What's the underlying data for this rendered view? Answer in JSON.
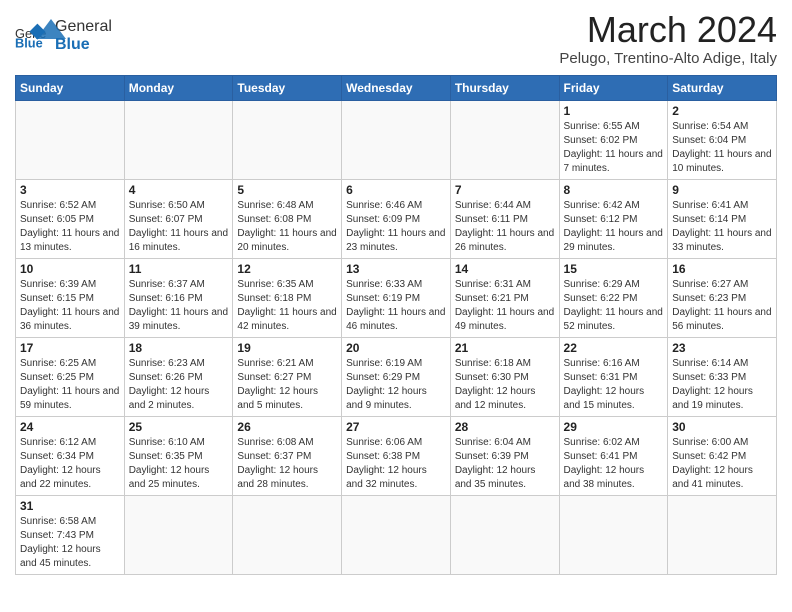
{
  "logo": {
    "text_general": "General",
    "text_blue": "Blue"
  },
  "header": {
    "month_year": "March 2024",
    "location": "Pelugo, Trentino-Alto Adige, Italy"
  },
  "weekdays": [
    "Sunday",
    "Monday",
    "Tuesday",
    "Wednesday",
    "Thursday",
    "Friday",
    "Saturday"
  ],
  "weeks": [
    [
      {
        "day": "",
        "info": ""
      },
      {
        "day": "",
        "info": ""
      },
      {
        "day": "",
        "info": ""
      },
      {
        "day": "",
        "info": ""
      },
      {
        "day": "",
        "info": ""
      },
      {
        "day": "1",
        "info": "Sunrise: 6:55 AM\nSunset: 6:02 PM\nDaylight: 11 hours and 7 minutes."
      },
      {
        "day": "2",
        "info": "Sunrise: 6:54 AM\nSunset: 6:04 PM\nDaylight: 11 hours and 10 minutes."
      }
    ],
    [
      {
        "day": "3",
        "info": "Sunrise: 6:52 AM\nSunset: 6:05 PM\nDaylight: 11 hours and 13 minutes."
      },
      {
        "day": "4",
        "info": "Sunrise: 6:50 AM\nSunset: 6:07 PM\nDaylight: 11 hours and 16 minutes."
      },
      {
        "day": "5",
        "info": "Sunrise: 6:48 AM\nSunset: 6:08 PM\nDaylight: 11 hours and 20 minutes."
      },
      {
        "day": "6",
        "info": "Sunrise: 6:46 AM\nSunset: 6:09 PM\nDaylight: 11 hours and 23 minutes."
      },
      {
        "day": "7",
        "info": "Sunrise: 6:44 AM\nSunset: 6:11 PM\nDaylight: 11 hours and 26 minutes."
      },
      {
        "day": "8",
        "info": "Sunrise: 6:42 AM\nSunset: 6:12 PM\nDaylight: 11 hours and 29 minutes."
      },
      {
        "day": "9",
        "info": "Sunrise: 6:41 AM\nSunset: 6:14 PM\nDaylight: 11 hours and 33 minutes."
      }
    ],
    [
      {
        "day": "10",
        "info": "Sunrise: 6:39 AM\nSunset: 6:15 PM\nDaylight: 11 hours and 36 minutes."
      },
      {
        "day": "11",
        "info": "Sunrise: 6:37 AM\nSunset: 6:16 PM\nDaylight: 11 hours and 39 minutes."
      },
      {
        "day": "12",
        "info": "Sunrise: 6:35 AM\nSunset: 6:18 PM\nDaylight: 11 hours and 42 minutes."
      },
      {
        "day": "13",
        "info": "Sunrise: 6:33 AM\nSunset: 6:19 PM\nDaylight: 11 hours and 46 minutes."
      },
      {
        "day": "14",
        "info": "Sunrise: 6:31 AM\nSunset: 6:21 PM\nDaylight: 11 hours and 49 minutes."
      },
      {
        "day": "15",
        "info": "Sunrise: 6:29 AM\nSunset: 6:22 PM\nDaylight: 11 hours and 52 minutes."
      },
      {
        "day": "16",
        "info": "Sunrise: 6:27 AM\nSunset: 6:23 PM\nDaylight: 11 hours and 56 minutes."
      }
    ],
    [
      {
        "day": "17",
        "info": "Sunrise: 6:25 AM\nSunset: 6:25 PM\nDaylight: 11 hours and 59 minutes."
      },
      {
        "day": "18",
        "info": "Sunrise: 6:23 AM\nSunset: 6:26 PM\nDaylight: 12 hours and 2 minutes."
      },
      {
        "day": "19",
        "info": "Sunrise: 6:21 AM\nSunset: 6:27 PM\nDaylight: 12 hours and 5 minutes."
      },
      {
        "day": "20",
        "info": "Sunrise: 6:19 AM\nSunset: 6:29 PM\nDaylight: 12 hours and 9 minutes."
      },
      {
        "day": "21",
        "info": "Sunrise: 6:18 AM\nSunset: 6:30 PM\nDaylight: 12 hours and 12 minutes."
      },
      {
        "day": "22",
        "info": "Sunrise: 6:16 AM\nSunset: 6:31 PM\nDaylight: 12 hours and 15 minutes."
      },
      {
        "day": "23",
        "info": "Sunrise: 6:14 AM\nSunset: 6:33 PM\nDaylight: 12 hours and 19 minutes."
      }
    ],
    [
      {
        "day": "24",
        "info": "Sunrise: 6:12 AM\nSunset: 6:34 PM\nDaylight: 12 hours and 22 minutes."
      },
      {
        "day": "25",
        "info": "Sunrise: 6:10 AM\nSunset: 6:35 PM\nDaylight: 12 hours and 25 minutes."
      },
      {
        "day": "26",
        "info": "Sunrise: 6:08 AM\nSunset: 6:37 PM\nDaylight: 12 hours and 28 minutes."
      },
      {
        "day": "27",
        "info": "Sunrise: 6:06 AM\nSunset: 6:38 PM\nDaylight: 12 hours and 32 minutes."
      },
      {
        "day": "28",
        "info": "Sunrise: 6:04 AM\nSunset: 6:39 PM\nDaylight: 12 hours and 35 minutes."
      },
      {
        "day": "29",
        "info": "Sunrise: 6:02 AM\nSunset: 6:41 PM\nDaylight: 12 hours and 38 minutes."
      },
      {
        "day": "30",
        "info": "Sunrise: 6:00 AM\nSunset: 6:42 PM\nDaylight: 12 hours and 41 minutes."
      }
    ],
    [
      {
        "day": "31",
        "info": "Sunrise: 6:58 AM\nSunset: 7:43 PM\nDaylight: 12 hours and 45 minutes."
      },
      {
        "day": "",
        "info": ""
      },
      {
        "day": "",
        "info": ""
      },
      {
        "day": "",
        "info": ""
      },
      {
        "day": "",
        "info": ""
      },
      {
        "day": "",
        "info": ""
      },
      {
        "day": "",
        "info": ""
      }
    ]
  ]
}
